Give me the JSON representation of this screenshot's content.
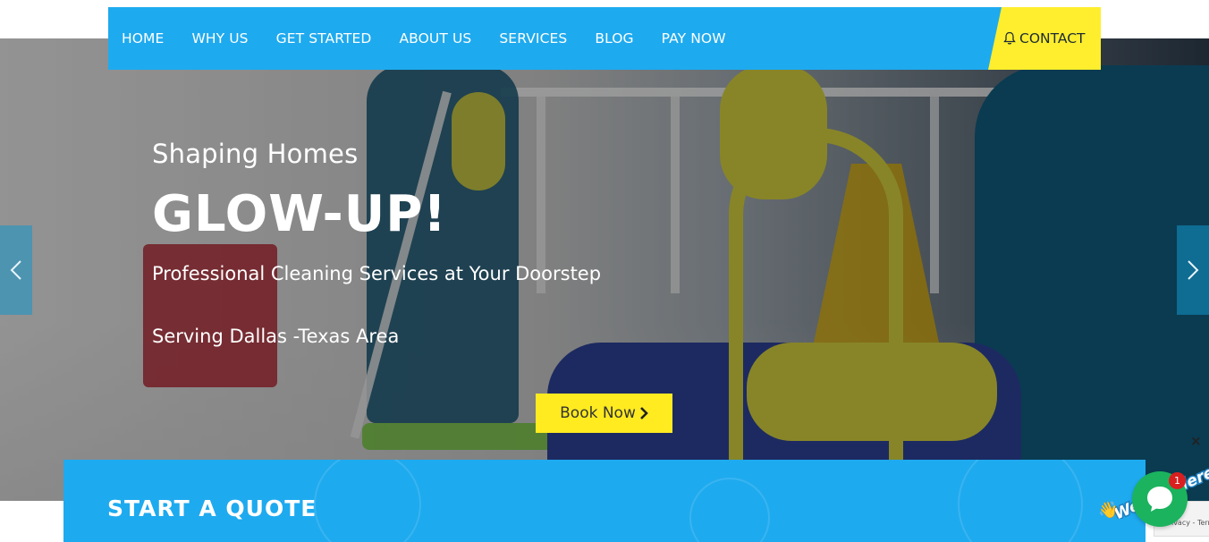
{
  "nav": {
    "items": [
      {
        "label": "HOME"
      },
      {
        "label": "WHY US"
      },
      {
        "label": "GET STARTED"
      },
      {
        "label": "ABOUT US"
      },
      {
        "label": "SERVICES"
      },
      {
        "label": "BLOG"
      },
      {
        "label": "PAY NOW"
      }
    ],
    "contact_label": "CONTACT",
    "contact_icon": "bell-icon"
  },
  "hero": {
    "eyebrow": "Shaping Homes",
    "headline": "GLOW-UP!",
    "tagline": "Professional Cleaning Services at Your Doorstep",
    "area": "Serving Dallas -Texas Area",
    "cta_label": "Book Now",
    "prev_icon": "chevron-left-icon",
    "next_icon": "chevron-right-icon"
  },
  "quote": {
    "title": "START A QUOTE"
  },
  "chat": {
    "banner_text": "We Are Here!",
    "badge_count": "1",
    "close_label": "×"
  },
  "recaptcha": {
    "text": "Privacy - Terms"
  },
  "colors": {
    "primary": "#1eaaef",
    "accent": "#ffee2d",
    "chat_green": "#1bb35e",
    "badge_red": "#d91f1f"
  }
}
